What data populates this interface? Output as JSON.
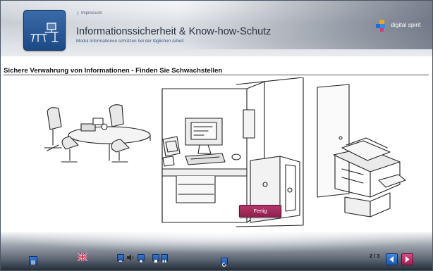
{
  "header": {
    "impressum_link": "Impressum",
    "title": "Informationssicherheit & Know-how-Schutz",
    "subtitle": "Modul Informationen schützen bei der täglichen Arbeit",
    "brand": "digital spirit"
  },
  "section": {
    "title": "Sichere Verwahrung von Informationen - Finden Sie Schwachstellen"
  },
  "scene": {
    "done_button_label": "Fertig"
  },
  "footer": {
    "page_counter": "2 / 3",
    "icons": [
      "menu-icon",
      "flag-icon",
      "volume-down-icon",
      "speaker-icon",
      "volume-up-icon",
      "stop-icon",
      "pause-icon",
      "replay-icon",
      "previous-arrow-icon",
      "next-arrow-icon"
    ]
  },
  "colors": {
    "accent_magenta": "#9c1f56",
    "accent_blue": "#1b55a8",
    "header_text": "#2a3240",
    "subtitle_text": "#3d5f8f"
  }
}
